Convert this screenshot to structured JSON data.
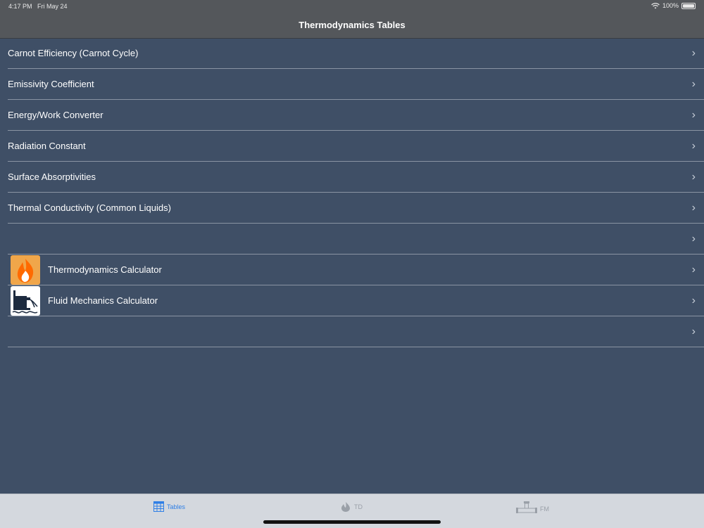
{
  "status": {
    "time": "4:17 PM",
    "date": "Fri May 24",
    "battery": "100%"
  },
  "nav": {
    "title": "Thermodynamics Tables"
  },
  "list": {
    "items": [
      {
        "label": "Carnot Efficiency (Carnot Cycle)"
      },
      {
        "label": "Emissivity Coefficient"
      },
      {
        "label": "Energy/Work Converter"
      },
      {
        "label": "Radiation Constant"
      },
      {
        "label": "Surface Absorptivities"
      },
      {
        "label": "Thermal Conductivity (Common Liquids)"
      },
      {
        "label": ""
      },
      {
        "label": "Thermodynamics Calculator",
        "icon": "flame-icon"
      },
      {
        "label": "Fluid Mechanics Calculator",
        "icon": "fluid-tank-icon"
      },
      {
        "label": ""
      }
    ],
    "chevron": "›"
  },
  "tabs": [
    {
      "label": "Tables",
      "icon": "table-icon",
      "active": true
    },
    {
      "label": "TD",
      "icon": "td-flame-icon"
    },
    {
      "label": "FM",
      "icon": "pipe-icon"
    }
  ],
  "colors": {
    "background": "#3f4f66",
    "bar": "#54575b",
    "tab_active": "#2f7fe6",
    "tab_inactive": "#9aa0a8"
  }
}
